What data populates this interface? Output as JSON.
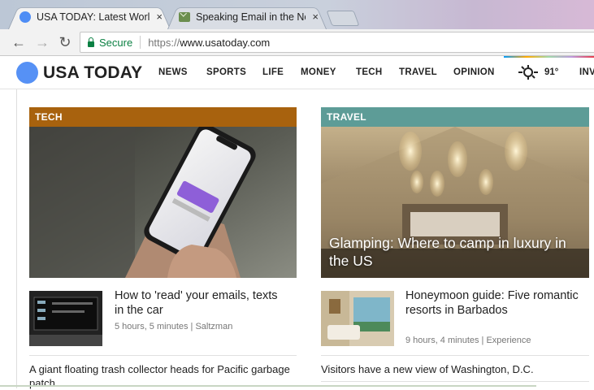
{
  "browser": {
    "tabs": [
      {
        "title": "USA TODAY: Latest Worl",
        "active": true,
        "icon": "usatoday-favicon"
      },
      {
        "title": "Speaking Email in the Ne",
        "active": false,
        "icon": "email-favicon"
      }
    ],
    "close_glyph": "×",
    "back_glyph": "←",
    "forward_glyph": "→",
    "reload_glyph": "↻",
    "secure_label": "Secure",
    "url_scheme": "https://",
    "url_host": "www.usatoday.com"
  },
  "site": {
    "logo": "USA TODAY",
    "brand_color": "#5691f5",
    "nav": [
      "NEWS",
      "SPORTS",
      "LIFE",
      "MONEY",
      "TECH",
      "TRAVEL",
      "OPINION"
    ],
    "weather_temp": "91°",
    "nav_overflow": "INV"
  },
  "sections": {
    "tech": {
      "label": "TECH",
      "color": "#a8620e",
      "stories": [
        {
          "title": "How to 'read' your emails, texts in the car",
          "meta": "5 hours, 5 minutes | Saltzman"
        }
      ],
      "teaser": "A giant floating trash collector heads for Pacific garbage patch"
    },
    "travel": {
      "label": "TRAVEL",
      "color": "#5d9c97",
      "hero_caption": "Glamping: Where to camp in luxury in the US",
      "stories": [
        {
          "title": "Honeymoon guide: Five romantic resorts in Barbados",
          "meta": "9 hours, 4 minutes | Experience"
        }
      ],
      "teaser": "Visitors have a new view of Washington, D.C."
    }
  }
}
